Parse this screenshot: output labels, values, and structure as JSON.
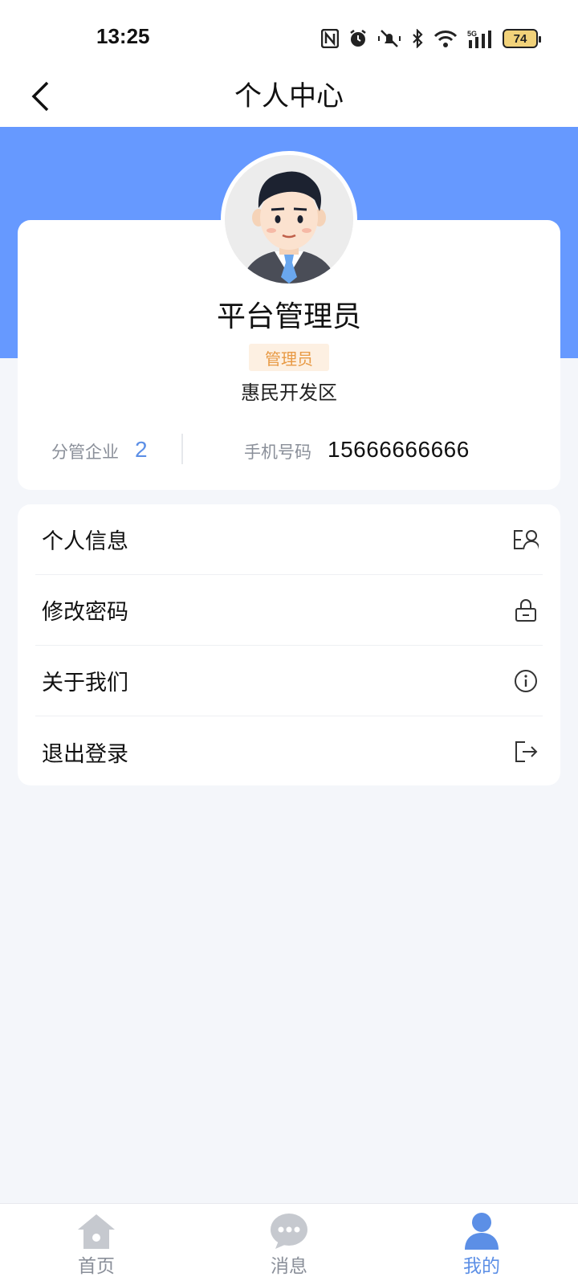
{
  "status_bar": {
    "time": "13:25",
    "battery": "74",
    "icons": [
      "nfc-icon",
      "alarm-icon",
      "mute-icon",
      "bluetooth-icon",
      "wifi-icon",
      "signal-5g-icon"
    ]
  },
  "header": {
    "title": "个人中心"
  },
  "profile": {
    "name": "平台管理员",
    "role": "管理员",
    "district": "惠民开发区",
    "company_label": "分管企业",
    "company_count": "2",
    "phone_label": "手机号码",
    "phone": "15666666666"
  },
  "menu": {
    "items": [
      {
        "label": "个人信息",
        "icon": "user-profile-icon"
      },
      {
        "label": "修改密码",
        "icon": "lock-icon"
      },
      {
        "label": "关于我们",
        "icon": "info-icon"
      },
      {
        "label": "退出登录",
        "icon": "logout-icon"
      }
    ]
  },
  "tabbar": {
    "tabs": [
      {
        "label": "首页",
        "icon": "home-icon"
      },
      {
        "label": "消息",
        "icon": "message-icon"
      },
      {
        "label": "我的",
        "icon": "person-icon",
        "active": true
      }
    ]
  },
  "colors": {
    "accent": "#6699ff",
    "active_tab": "#5c8fe6",
    "badge_bg": "#fdf0e2",
    "badge_text": "#e89a45",
    "page_bg": "#f4f6fa"
  }
}
